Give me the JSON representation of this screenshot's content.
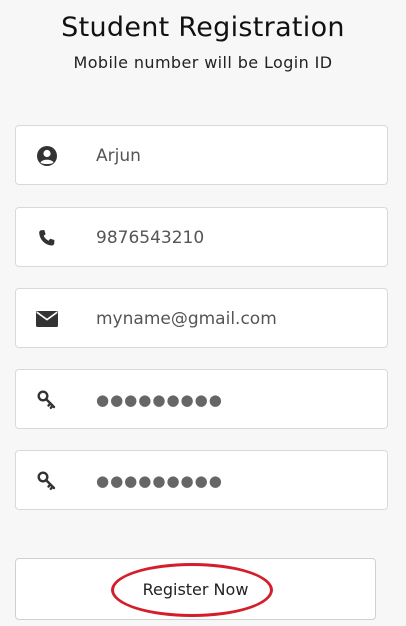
{
  "header": {
    "title": "Student Registration",
    "subtitle": "Mobile number will be Login ID"
  },
  "form": {
    "fields": [
      {
        "icon": "user-circle-icon",
        "value": "Arjun"
      },
      {
        "icon": "phone-icon",
        "value": "9876543210"
      },
      {
        "icon": "envelope-icon",
        "value": "myname@gmail.com"
      },
      {
        "icon": "key-icon",
        "value": "●●●●●●●●●"
      },
      {
        "icon": "key-icon",
        "value": "●●●●●●●●●"
      }
    ],
    "submit_label": "Register Now"
  },
  "colors": {
    "annotation": "#d41e2a",
    "icon": "#333333"
  }
}
